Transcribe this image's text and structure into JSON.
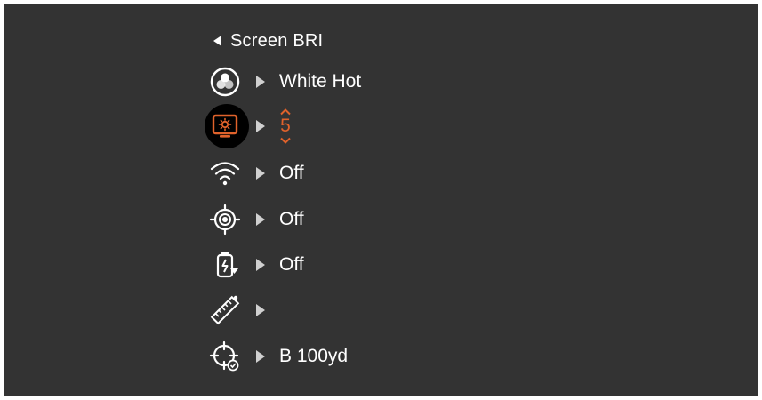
{
  "menu": {
    "title": "Screen BRI",
    "accent_color": "#e0622b",
    "items": [
      {
        "icon": "palette-icon",
        "value": "White Hot"
      },
      {
        "icon": "screen-brightness-icon",
        "value": "5",
        "selected": true
      },
      {
        "icon": "wifi-icon",
        "value": "Off"
      },
      {
        "icon": "target-icon",
        "value": "Off"
      },
      {
        "icon": "battery-saver-icon",
        "value": "Off"
      },
      {
        "icon": "ruler-icon",
        "value": ""
      },
      {
        "icon": "zeroing-crosshair-icon",
        "value": "B 100yd"
      }
    ]
  }
}
